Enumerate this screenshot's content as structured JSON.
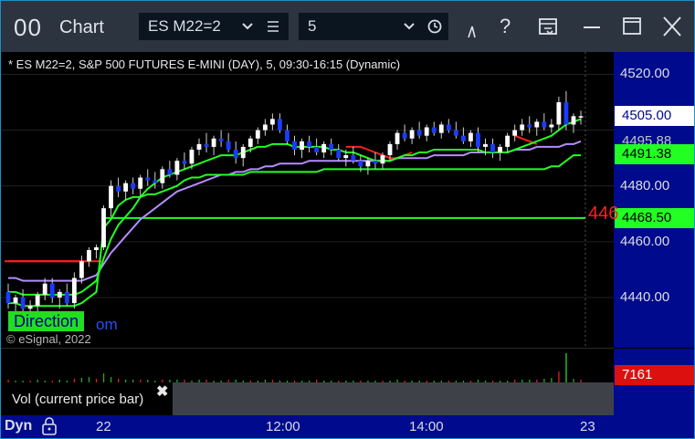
{
  "window": {
    "app_icon": "00",
    "title": "Chart",
    "symbol": "ES M22=2",
    "interval": "5",
    "colors": {
      "titlebar": "#2c3440",
      "axis_bg": "#000a8c",
      "border": "#1e90c8"
    }
  },
  "toolbar": {
    "icons": [
      "chevron-down-icon",
      "menu-lines-icon",
      "chevron-down-icon",
      "clock-icon",
      "draw-tool-icon",
      "help-icon",
      "page-layout-icon",
      "minimize-icon",
      "maximize-icon",
      "close-icon"
    ],
    "help_label": "?"
  },
  "chart": {
    "header": "* ES M22=2, S&P 500 FUTURES E-MINI (DAY), 5, 09:30-16:15 (Dynamic)",
    "copyright": "© eSignal, 2022",
    "direction_label": "Direction",
    "direction_suffix": "om",
    "red_partial_label": "446",
    "price_ticks": [
      "4520.00",
      "4480.00",
      "4460.00",
      "4440.00"
    ],
    "price_labels": [
      {
        "text": "4505.00",
        "bg": "#ffffff",
        "fg": "#000a8c"
      },
      {
        "text": "4495.88",
        "bg": "#000a8c",
        "fg": "#c0c0c0"
      },
      {
        "text": "4491.38",
        "bg": "#22ff22",
        "fg": "#000000"
      },
      {
        "text": "4468.50",
        "bg": "#22ff22",
        "fg": "#000000"
      }
    ],
    "time_labels": [
      "22",
      "12:00",
      "14:00",
      "23"
    ],
    "status_left": "Dyn"
  },
  "volume": {
    "legend": "Vol (current price bar)",
    "close_glyph": "✖",
    "value_label": "7161",
    "value_bg": "#dd1010"
  },
  "chart_data": {
    "type": "candlestick",
    "symbol": "ES M22=2",
    "ylim": [
      4422,
      4528
    ],
    "levels": {
      "current_price": 4505.0,
      "purple_ma": 4495.88,
      "green_upper": 4491.38,
      "green_lower": 4468.5
    },
    "candles": [
      [
        4442,
        4445,
        4436,
        4438
      ],
      [
        4438,
        4441,
        4433,
        4440
      ],
      [
        4440,
        4443,
        4434,
        4436
      ],
      [
        4436,
        4439,
        4431,
        4437
      ],
      [
        4437,
        4442,
        4435,
        4441
      ],
      [
        4441,
        4447,
        4439,
        4445
      ],
      [
        4445,
        4447,
        4438,
        4440
      ],
      [
        4440,
        4443,
        4436,
        4442
      ],
      [
        4442,
        4445,
        4437,
        4438
      ],
      [
        4438,
        4449,
        4436,
        4447
      ],
      [
        4447,
        4455,
        4445,
        4453
      ],
      [
        4453,
        4458,
        4451,
        4457
      ],
      [
        4457,
        4459,
        4454,
        4458
      ],
      [
        4458,
        4473,
        4457,
        4472
      ],
      [
        4472,
        4482,
        4469,
        4480
      ],
      [
        4480,
        4483,
        4476,
        4478
      ],
      [
        4478,
        4482,
        4475,
        4481
      ],
      [
        4481,
        4483,
        4477,
        4479
      ],
      [
        4479,
        4484,
        4476,
        4483
      ],
      [
        4483,
        4486,
        4480,
        4482
      ],
      [
        4482,
        4485,
        4479,
        4481
      ],
      [
        4481,
        4487,
        4479,
        4486
      ],
      [
        4486,
        4489,
        4483,
        4484
      ],
      [
        4484,
        4490,
        4482,
        4489
      ],
      [
        4489,
        4492,
        4486,
        4488
      ],
      [
        4488,
        4494,
        4486,
        4493
      ],
      [
        4493,
        4497,
        4491,
        4495
      ],
      [
        4495,
        4499,
        4492,
        4494
      ],
      [
        4494,
        4498,
        4491,
        4497
      ],
      [
        4497,
        4500,
        4494,
        4496
      ],
      [
        4496,
        4499,
        4492,
        4493
      ],
      [
        4493,
        4496,
        4488,
        4490
      ],
      [
        4490,
        4495,
        4487,
        4494
      ],
      [
        4494,
        4498,
        4492,
        4497
      ],
      [
        4497,
        4501,
        4495,
        4500
      ],
      [
        4500,
        4504,
        4498,
        4502
      ],
      [
        4502,
        4506,
        4500,
        4504
      ],
      [
        4504,
        4506,
        4499,
        4500
      ],
      [
        4500,
        4502,
        4495,
        4496
      ],
      [
        4496,
        4498,
        4491,
        4493
      ],
      [
        4493,
        4497,
        4490,
        4496
      ],
      [
        4496,
        4498,
        4492,
        4494
      ],
      [
        4494,
        4497,
        4491,
        4492
      ],
      [
        4492,
        4496,
        4490,
        4495
      ],
      [
        4495,
        4497,
        4491,
        4493
      ],
      [
        4493,
        4495,
        4489,
        4490
      ],
      [
        4490,
        4493,
        4487,
        4491
      ],
      [
        4491,
        4494,
        4488,
        4489
      ],
      [
        4489,
        4491,
        4485,
        4487
      ],
      [
        4487,
        4490,
        4484,
        4489
      ],
      [
        4489,
        4492,
        4486,
        4488
      ],
      [
        4488,
        4492,
        4486,
        4491
      ],
      [
        4491,
        4496,
        4489,
        4495
      ],
      [
        4495,
        4500,
        4493,
        4499
      ],
      [
        4499,
        4502,
        4496,
        4497
      ],
      [
        4497,
        4501,
        4495,
        4500
      ],
      [
        4500,
        4503,
        4497,
        4498
      ],
      [
        4498,
        4502,
        4496,
        4501
      ],
      [
        4501,
        4503,
        4498,
        4499
      ],
      [
        4499,
        4503,
        4497,
        4502
      ],
      [
        4502,
        4504,
        4499,
        4500
      ],
      [
        4500,
        4503,
        4497,
        4498
      ],
      [
        4498,
        4501,
        4495,
        4496
      ],
      [
        4496,
        4500,
        4494,
        4499
      ],
      [
        4499,
        4501,
        4492,
        4494
      ],
      [
        4494,
        4497,
        4491,
        4495
      ],
      [
        4495,
        4497,
        4490,
        4492
      ],
      [
        4492,
        4495,
        4489,
        4494
      ],
      [
        4494,
        4499,
        4492,
        4498
      ],
      [
        4498,
        4502,
        4496,
        4500
      ],
      [
        4500,
        4504,
        4498,
        4502
      ],
      [
        4502,
        4505,
        4499,
        4501
      ],
      [
        4501,
        4504,
        4498,
        4503
      ],
      [
        4503,
        4506,
        4500,
        4501
      ],
      [
        4501,
        4504,
        4499,
        4502
      ],
      [
        4502,
        4512,
        4500,
        4510
      ],
      [
        4510,
        4514,
        4500,
        4502
      ],
      [
        4502,
        4506,
        4499,
        4505
      ],
      [
        4505,
        4507,
        4502,
        4505
      ]
    ],
    "series": [
      {
        "name": "red",
        "color": "#ff2020",
        "values": [
          4453,
          4453,
          4453,
          4453,
          4453,
          4453,
          4453,
          4453,
          4453,
          4453,
          4453,
          4453,
          null,
          null,
          null,
          null,
          null,
          null,
          null,
          null,
          null,
          null,
          null,
          null,
          null,
          null,
          null,
          null,
          null,
          null,
          null,
          null,
          null,
          null,
          null,
          null,
          null,
          null,
          null,
          null,
          null,
          null,
          null,
          null,
          null,
          null,
          4494,
          4494,
          4494,
          4493,
          4492,
          4491,
          4490,
          4490,
          4491,
          4492,
          null,
          null,
          null,
          null,
          null,
          null,
          null,
          null,
          null,
          null,
          null,
          null,
          null,
          4498,
          4497,
          4496,
          4495,
          null,
          null,
          null,
          null,
          null,
          null
        ]
      },
      {
        "name": "purple",
        "color": "#b48cff",
        "values": [
          4447,
          4447,
          4446,
          4446,
          4446,
          4446,
          4446,
          4446,
          4446,
          4446,
          4446,
          4447,
          4448,
          4452,
          4456,
          4459,
          4462,
          4465,
          4468,
          4470,
          4472,
          4474,
          4476,
          4478,
          4479,
          4480,
          4481,
          4482,
          4483,
          4484,
          4484,
          4485,
          4485,
          4486,
          4486,
          4487,
          4487,
          4488,
          4488,
          4488,
          4488,
          4489,
          4489,
          4489,
          4489,
          4489,
          4489,
          4489,
          4489,
          4489,
          4489,
          4489,
          4489,
          4490,
          4490,
          4490,
          4490,
          4490,
          4491,
          4491,
          4491,
          4491,
          4491,
          4492,
          4492,
          4492,
          4492,
          4492,
          4492,
          4493,
          4493,
          4493,
          4494,
          4494,
          4494,
          4494,
          4495,
          4495,
          4496
        ]
      },
      {
        "name": "green_upper",
        "color": "#22ff22",
        "values": [
          4442,
          4442,
          4441,
          4441,
          4441,
          4441,
          4441,
          4441,
          4441,
          4441,
          4442,
          4444,
          4446,
          4454,
          4461,
          4466,
          4469,
          4472,
          4476,
          4479,
          4481,
          4483,
          4484,
          4485,
          4486,
          4487,
          4488,
          4489,
          4490,
          4491,
          4491,
          4491,
          4492,
          4493,
          4494,
          4494,
          4495,
          4495,
          4495,
          4494,
          4494,
          4494,
          4494,
          4494,
          4493,
          4493,
          4492,
          4492,
          4491,
          4490,
          4489,
          4489,
          4489,
          4490,
          4491,
          4491,
          4492,
          4492,
          4493,
          4493,
          4493,
          4493,
          4493,
          4493,
          4493,
          4492,
          4492,
          4492,
          4492,
          4493,
          4494,
          4495,
          4496,
          4497,
          4498,
          4500,
          4502,
          4503,
          4504
        ]
      },
      {
        "name": "green_lower",
        "color": "#22ff22",
        "values": [
          4438,
          4438,
          4437,
          4437,
          4437,
          4437,
          4437,
          4437,
          4437,
          4437,
          4438,
          4440,
          4442,
          4465,
          4468,
          4473,
          4475,
          4476,
          4476,
          4477,
          4477,
          4478,
          4479,
          4480,
          4482,
          4483,
          4483,
          4484,
          4484,
          4484,
          4484,
          4484,
          4484,
          4485,
          4485,
          4485,
          4485,
          4485,
          4485,
          4485,
          4485,
          4485,
          4485,
          4486,
          4486,
          4486,
          4486,
          4486,
          4486,
          4486,
          4486,
          4486,
          4486,
          4486,
          4486,
          4486,
          4486,
          4486,
          4486,
          4486,
          4486,
          4486,
          4486,
          4486,
          4486,
          4486,
          4486,
          4486,
          4486,
          4486,
          4486,
          4486,
          4486,
          4486,
          4487,
          4487,
          4489,
          4491,
          4491
        ]
      }
    ],
    "volume_values": [
      3,
      2,
      2,
      2,
      3,
      2,
      2,
      3,
      2,
      4,
      5,
      6,
      4,
      10,
      6,
      4,
      3,
      3,
      3,
      3,
      2,
      3,
      3,
      3,
      3,
      2,
      3,
      3,
      2,
      2,
      3,
      3,
      2,
      2,
      2,
      3,
      3,
      2,
      2,
      2,
      2,
      2,
      3,
      2,
      2,
      2,
      2,
      2,
      2,
      2,
      2,
      2,
      2,
      3,
      2,
      2,
      2,
      2,
      2,
      2,
      2,
      2,
      2,
      2,
      3,
      2,
      2,
      2,
      2,
      3,
      3,
      3,
      3,
      4,
      5,
      12,
      32,
      4,
      3
    ],
    "volume_ylim": [
      0,
      35
    ]
  }
}
